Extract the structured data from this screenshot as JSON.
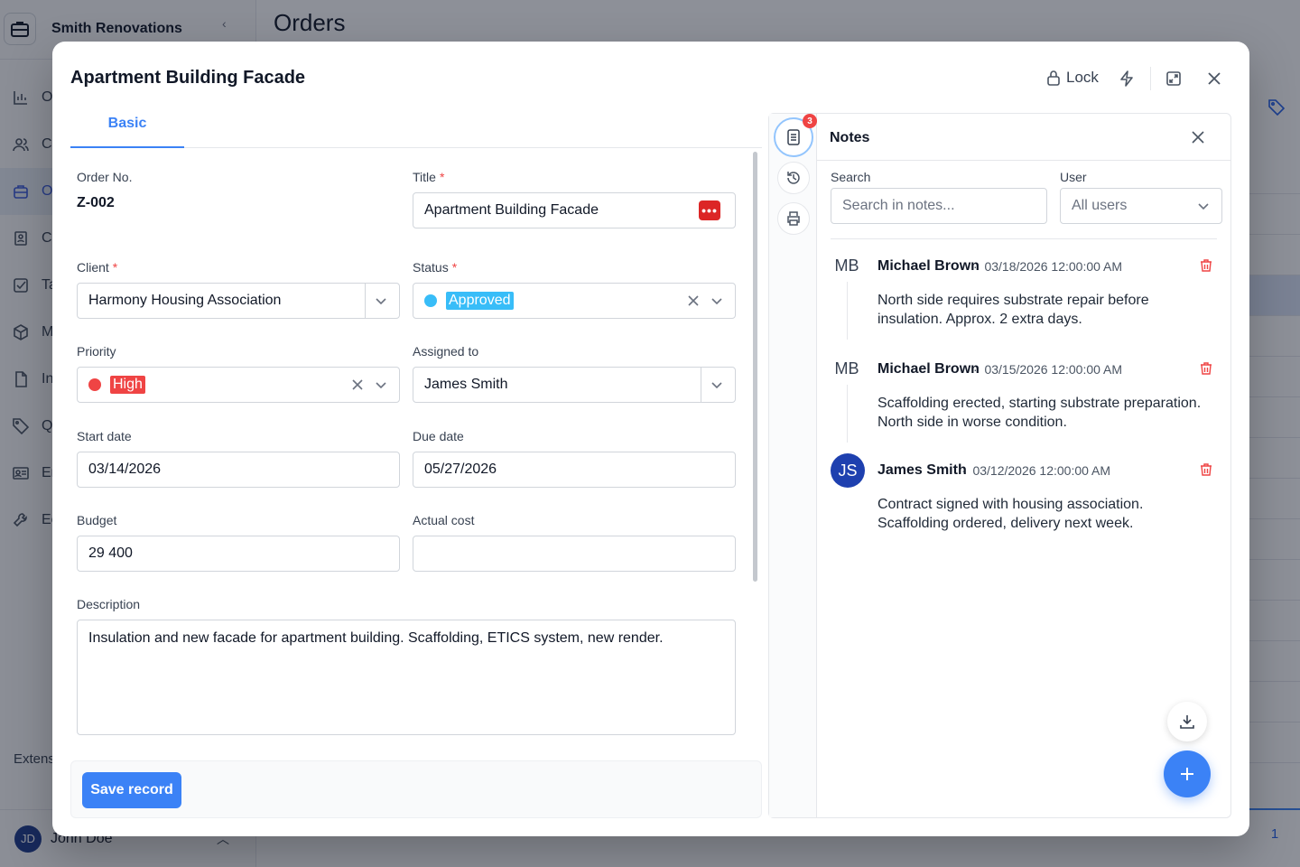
{
  "background": {
    "company_name": "Smith Renovations",
    "page_title": "Orders",
    "nav_items": [
      {
        "label": "O",
        "icon": "chart-icon"
      },
      {
        "label": "Cl",
        "icon": "users-icon"
      },
      {
        "label": "O",
        "icon": "briefcase-icon"
      },
      {
        "label": "Co",
        "icon": "contacts-icon"
      },
      {
        "label": "Ta",
        "icon": "checkbox-icon"
      },
      {
        "label": "M",
        "icon": "box-icon"
      },
      {
        "label": "In",
        "icon": "document-icon"
      },
      {
        "label": "Q",
        "icon": "tag-icon"
      },
      {
        "label": "Er",
        "icon": "id-card-icon"
      },
      {
        "label": "Ec",
        "icon": "wrench-icon"
      }
    ],
    "section_label": "Extens",
    "user": {
      "initials": "JD",
      "name": "John Doe"
    },
    "pagination_page": "1"
  },
  "modal": {
    "title": "Apartment Building Facade",
    "lock_label": "Lock",
    "tabs": [
      {
        "label": "Basic"
      }
    ],
    "form": {
      "order_no": {
        "label": "Order No.",
        "value": "Z-002"
      },
      "title": {
        "label": "Title",
        "required_mark": "*",
        "value": "Apartment Building Facade",
        "btn_glyph": "•••"
      },
      "client": {
        "label": "Client",
        "required_mark": "*",
        "value": "Harmony Housing Association"
      },
      "status": {
        "label": "Status",
        "required_mark": "*",
        "value": "Approved",
        "color": "#38bdf8"
      },
      "priority": {
        "label": "Priority",
        "value": "High",
        "color": "#ef4444"
      },
      "assigned_to": {
        "label": "Assigned to",
        "value": "James Smith"
      },
      "start_date": {
        "label": "Start date",
        "value": "03/14/2026"
      },
      "due_date": {
        "label": "Due date",
        "value": "05/27/2026"
      },
      "budget": {
        "label": "Budget",
        "value": "29 400"
      },
      "actual_cost": {
        "label": "Actual cost",
        "value": ""
      },
      "description": {
        "label": "Description",
        "value": "Insulation and new facade for apartment building. Scaffolding, ETICS system, new render."
      }
    },
    "save_label": "Save record",
    "accent_color": "#3b82f6"
  },
  "notes_panel": {
    "badge_count": "3",
    "title": "Notes",
    "search_label": "Search",
    "search_placeholder": "Search in notes...",
    "user_label": "User",
    "user_value": "All users",
    "notes": [
      {
        "initials": "MB",
        "author": "Michael Brown",
        "sep": "·",
        "date": "03/18/2026 12:00:00 AM",
        "text": "North side requires substrate repair before insulation. Approx. 2 extra days."
      },
      {
        "initials": "MB",
        "author": "Michael Brown",
        "sep": "·",
        "date": "03/15/2026 12:00:00 AM",
        "text": "Scaffolding erected, starting substrate preparation. North side in worse condition."
      },
      {
        "initials": "JS",
        "author": "James Smith",
        "sep": "·",
        "date": "03/12/2026 12:00:00 AM",
        "text": "Contract signed with housing association. Scaffolding ordered, delivery next week."
      }
    ]
  }
}
